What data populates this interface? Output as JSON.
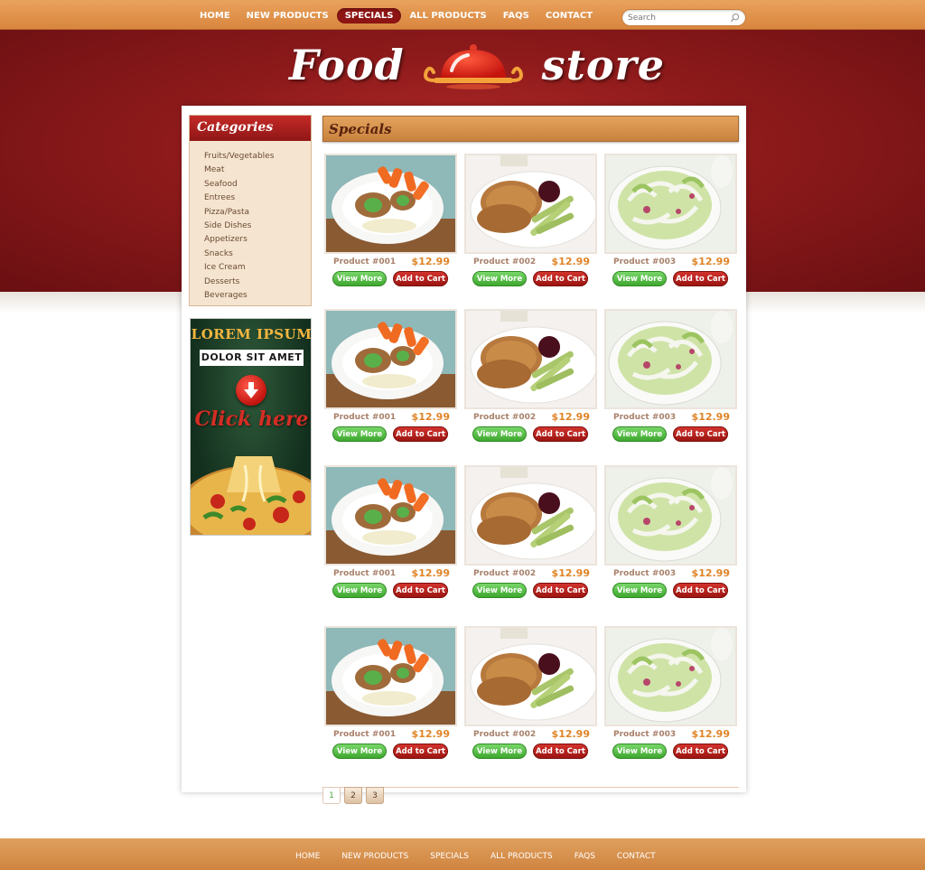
{
  "nav": {
    "items": [
      "HOME",
      "NEW PRODUCTS",
      "SPECIALS",
      "ALL PRODUCTS",
      "FAQS",
      "CONTACT"
    ],
    "active": "SPECIALS"
  },
  "search": {
    "placeholder": "Search",
    "icon": "search-icon"
  },
  "logo": {
    "word1": "Food",
    "word2": "store",
    "icon": "cloche-icon"
  },
  "categories": {
    "title": "Categories",
    "items": [
      "Fruits/Vegetables",
      "Meat",
      "Seafood",
      "Entrees",
      "Pizza/Pasta",
      "Side Dishes",
      "Appetizers",
      "Snacks",
      "Ice Cream",
      "Desserts",
      "Beverages"
    ]
  },
  "promo": {
    "line1": "LOREM IPSUM",
    "line2": "DOLOR SIT AMET",
    "cta": "Click here",
    "icon": "arrow-down-icon"
  },
  "specials": {
    "title": "Specials"
  },
  "buttons": {
    "view_more": "View More",
    "add_to_cart": "Add to Cart"
  },
  "products": [
    [
      {
        "name": "Product #001",
        "price": "$12.99"
      },
      {
        "name": "Product #002",
        "price": "$12.99"
      },
      {
        "name": "Product #003",
        "price": "$12.99"
      }
    ],
    [
      {
        "name": "Product #001",
        "price": "$12.99"
      },
      {
        "name": "Product #002",
        "price": "$12.99"
      },
      {
        "name": "Product #003",
        "price": "$12.99"
      }
    ],
    [
      {
        "name": "Product #001",
        "price": "$12.99"
      },
      {
        "name": "Product #002",
        "price": "$12.99"
      },
      {
        "name": "Product #003",
        "price": "$12.99"
      }
    ],
    [
      {
        "name": "Product #001",
        "price": "$12.99"
      },
      {
        "name": "Product #002",
        "price": "$12.99"
      },
      {
        "name": "Product #003",
        "price": "$12.99"
      }
    ]
  ],
  "pagination": {
    "pages": [
      "1",
      "2",
      "3"
    ],
    "current": "1"
  },
  "footer": {
    "items": [
      "HOME",
      "NEW PRODUCTS",
      "SPECIALS",
      "ALL PRODUCTS",
      "FAQS",
      "CONTACT"
    ]
  },
  "colors": {
    "accent": "#8e1414",
    "nav": "#d9863f",
    "price": "#e08427",
    "view_more": "#3ea72f",
    "add_to_cart": "#9c1511"
  }
}
